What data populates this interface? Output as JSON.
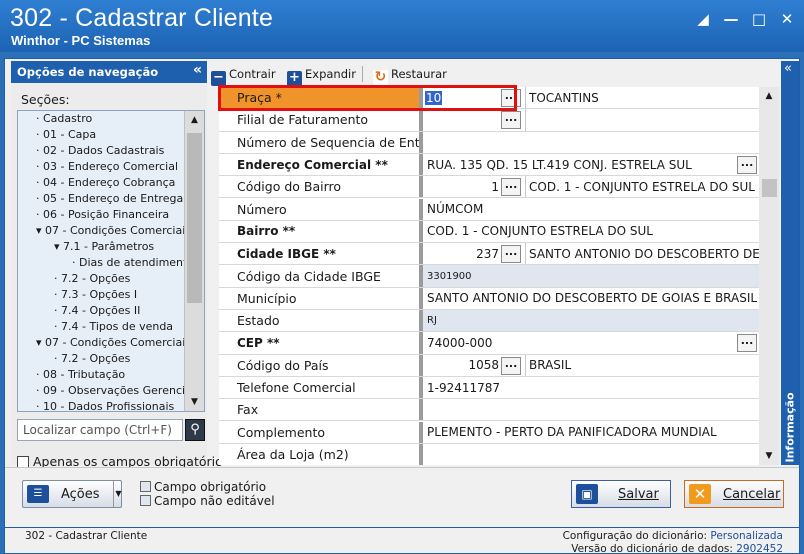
{
  "window": {
    "title": "302 - Cadastrar Cliente",
    "subtitle": "Winthor - PC Sistemas",
    "controls": [
      "restore-icon",
      "minimize-icon",
      "maximize-icon",
      "close-icon"
    ]
  },
  "nav": {
    "header": "Opções de navegação",
    "collapse": "«",
    "sections_label": "Seções:",
    "tree": [
      {
        "label": "Cadastro",
        "level": 0
      },
      {
        "label": "01 - Capa",
        "level": 0
      },
      {
        "label": "02 - Dados Cadastrais",
        "level": 0
      },
      {
        "label": "03 - Endereço Comercial",
        "level": 0
      },
      {
        "label": "04 - Endereço Cobrança",
        "level": 0
      },
      {
        "label": "05 - Endereço de Entrega",
        "level": 0
      },
      {
        "label": "06 - Posição Financeira",
        "level": 0
      },
      {
        "label": "07 - Condições Comerciais",
        "level": 0
      },
      {
        "label": "7.1 - Parâmetros",
        "level": 1
      },
      {
        "label": "Dias de atendimento",
        "level": 2
      },
      {
        "label": "7.2 - Opções",
        "level": 1
      },
      {
        "label": "7.3 - Opções I",
        "level": 1
      },
      {
        "label": "7.4 - Opções II",
        "level": 1
      },
      {
        "label": "7.4 - Tipos de venda",
        "level": 1
      },
      {
        "label": "07 - Condições Comerciais",
        "level": 0
      },
      {
        "label": "7.2 - Opções",
        "level": 1
      },
      {
        "label": "08 - Tributação",
        "level": 0
      },
      {
        "label": "09 - Observações Gerenciais",
        "level": 0
      },
      {
        "label": "10 - Dados Profissionais",
        "level": 0
      }
    ],
    "search_placeholder": "Localizar campo (Ctrl+F)",
    "only_required": "Apenas os campos obrigatório"
  },
  "toolbar": {
    "contrair": "Contrair",
    "expandir": "Expandir",
    "restaurar": "Restaurar"
  },
  "grid": {
    "rows": [
      {
        "label": "Praça *",
        "bold": false,
        "highlight": true,
        "num": "10",
        "selected": true,
        "ellipsis_left": true,
        "second": "TOCANTINS"
      },
      {
        "label": "Filial de Faturamento",
        "bold": false,
        "num": "",
        "ellipsis_left": true,
        "second": ""
      },
      {
        "label": "Número de Sequencia de Entre",
        "bold": false,
        "text": ""
      },
      {
        "label": "Endereço Comercial **",
        "bold": true,
        "text": "RUA. 135 QD. 15 LT.419 CONJ. ESTRELA SUL",
        "ellipsis_right": true
      },
      {
        "label": "Código do Bairro",
        "bold": false,
        "num": "1",
        "ellipsis_left": true,
        "second": "COD. 1 - CONJUNTO ESTRELA DO SUL"
      },
      {
        "label": "Número",
        "bold": false,
        "text": "NÚMCOM"
      },
      {
        "label": "Bairro **",
        "bold": true,
        "text": "COD. 1 - CONJUNTO ESTRELA DO SUL"
      },
      {
        "label": "Cidade IBGE **",
        "bold": true,
        "num": "237",
        "ellipsis_left": true,
        "second": "SANTO ANTONIO DO DESCOBERTO DE G"
      },
      {
        "label": "Código da Cidade IBGE",
        "bold": false,
        "text": "3301900",
        "small": true,
        "shade": true
      },
      {
        "label": "Município",
        "bold": false,
        "text": "SANTO ANTONIO DO DESCOBERTO DE GOIAS E BRASIL"
      },
      {
        "label": "Estado",
        "bold": false,
        "text": "RJ",
        "small": true,
        "shade": true
      },
      {
        "label": "CEP **",
        "bold": true,
        "text": "74000-000",
        "ellipsis_right": true
      },
      {
        "label": "Código do País",
        "bold": false,
        "num": "1058",
        "ellipsis_left": true,
        "second": "BRASIL"
      },
      {
        "label": "Telefone Comercial",
        "bold": false,
        "text": "1-92411787"
      },
      {
        "label": "Fax",
        "bold": false,
        "text": ""
      },
      {
        "label": "Complemento",
        "bold": false,
        "text": "PLEMENTO - PERTO DA PANIFICADORA MUNDIAL"
      },
      {
        "label": "Área da Loja (m2)",
        "bold": false,
        "text": ""
      }
    ]
  },
  "info_panel": {
    "label": "Informação",
    "collapse": "«"
  },
  "bottom": {
    "acoes": "Ações",
    "legend_required": "Campo obrigatório",
    "legend_readonly": "Campo não editável",
    "salvar": "Salvar",
    "cancelar": "Cancelar"
  },
  "status": {
    "left": "302 - Cadastrar Cliente",
    "config_label": "Configuração do dicionário:",
    "config_value": "Personalizada",
    "version_label": "Versão do dicionário de dados:",
    "version_value": "2902452"
  },
  "colors": {
    "title_bar": "#1d63b3",
    "highlight_label": "#f0932a",
    "red_frame": "#e01010",
    "link_value": "#1d4f9a"
  }
}
